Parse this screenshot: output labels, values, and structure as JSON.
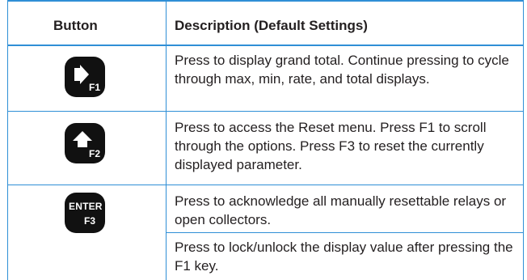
{
  "table": {
    "headers": {
      "button": "Button",
      "description": "Description (Default Settings)"
    },
    "rows": [
      {
        "icon": "arrow-right-icon",
        "key": "F1",
        "descriptions": [
          "Press to display grand total. Continue pressing to cycle through max, min, rate, and total displays."
        ]
      },
      {
        "icon": "arrow-up-icon",
        "key": "F2",
        "descriptions": [
          "Press to access the Reset menu. Press F1 to scroll through the options. Press F3 to reset the currently displayed parameter."
        ]
      },
      {
        "icon": "enter-icon",
        "key_top": "ENTER",
        "key": "F3",
        "descriptions": [
          "Press to acknowledge all manually resettable relays or open collectors.",
          "Press to lock/unlock the display value after pressing the F1 key."
        ]
      }
    ]
  },
  "colors": {
    "border": "#2f8fd6",
    "header_bg": "#ffffff",
    "button_bg": "#111111"
  }
}
